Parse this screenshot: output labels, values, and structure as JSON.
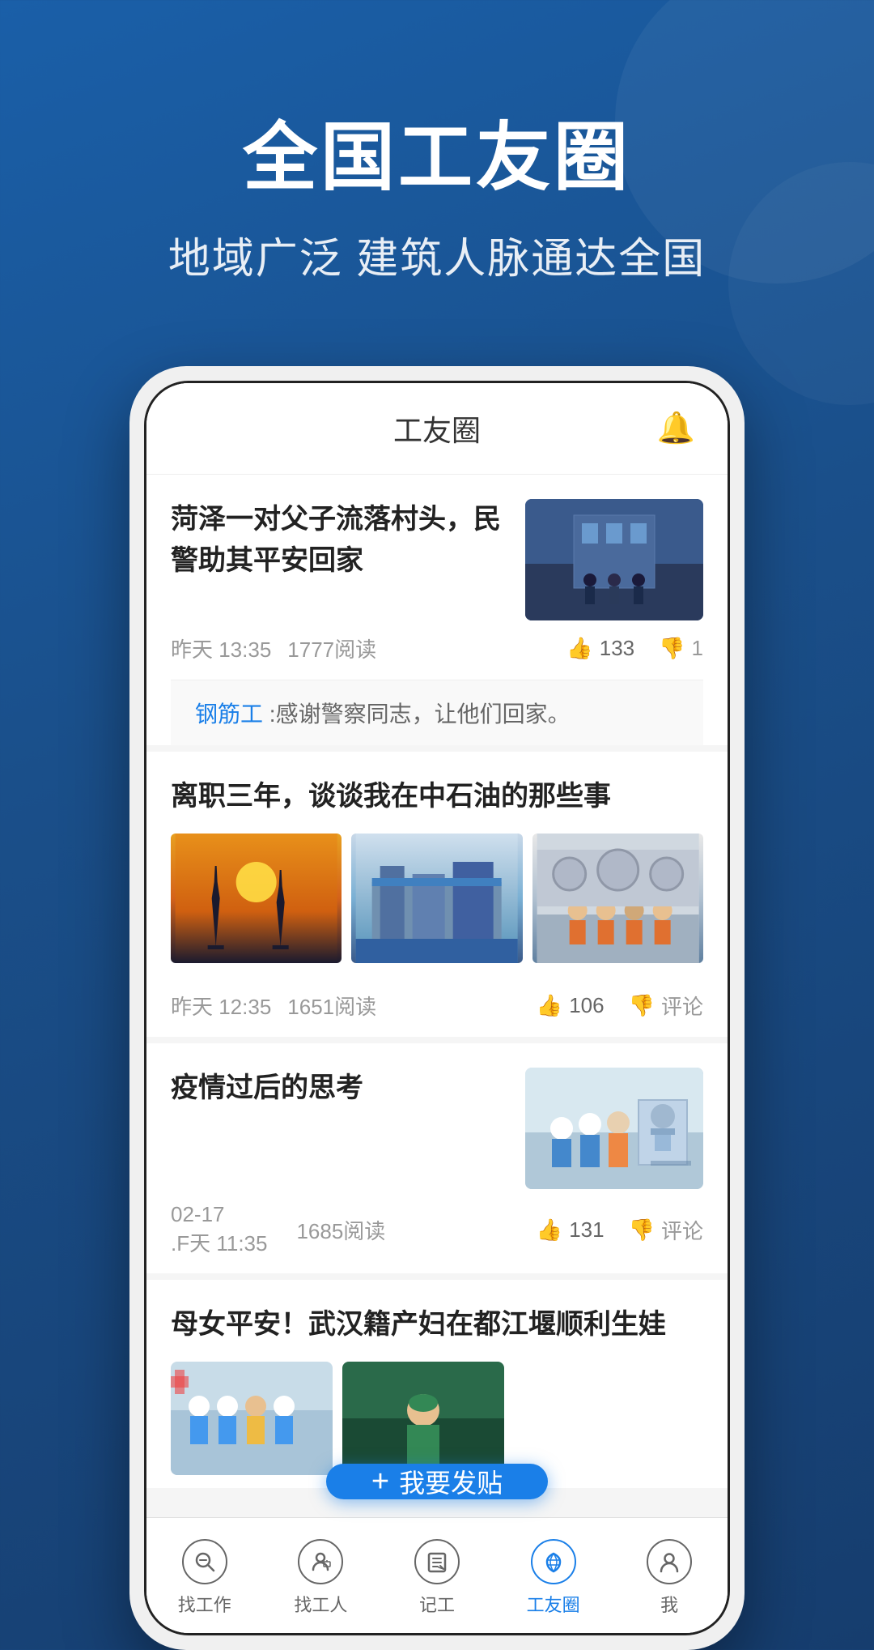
{
  "header": {
    "main_title": "全国工友圈",
    "sub_title": "地域广泛 建筑人脉通达全国"
  },
  "app": {
    "topbar": {
      "title": "工友圈",
      "bell_icon": "🔔"
    },
    "posts": [
      {
        "id": "post-1",
        "title": "菏泽一对父子流落村头，民警助其平安回家",
        "time": "昨天 13:35",
        "reads": "1777阅读",
        "likes": "133",
        "dislikes": "1",
        "has_single_image": true,
        "image_type": "police",
        "comment": {
          "username": "钢筋工",
          "text": ":感谢警察同志，让他们回家。"
        }
      },
      {
        "id": "post-2",
        "title": "离职三年，谈谈我在中石油的那些事",
        "time": "昨天 12:35",
        "reads": "1651阅读",
        "likes": "106",
        "dislikes_label": "评论",
        "has_three_images": true,
        "images": [
          "oil1",
          "oil2",
          "oil3"
        ]
      },
      {
        "id": "post-3",
        "title": "疫情过后的思考",
        "time": "02-17\n.F天 11:35",
        "reads": "1685阅读",
        "likes": "131",
        "dislikes_label": "评论",
        "has_single_image": true,
        "image_type": "pandemic"
      },
      {
        "id": "post-4",
        "title": "母女平安！武汉籍产妇在都江堰顺利生娃",
        "has_two_images": true,
        "images": [
          "baby",
          "baby2"
        ]
      }
    ],
    "fab": {
      "plus": "+",
      "label": "我要发贴"
    },
    "bottom_nav": [
      {
        "id": "find-work",
        "icon": "🔍",
        "label": "找工作",
        "active": false
      },
      {
        "id": "find-worker",
        "icon": "👔",
        "label": "找工人",
        "active": false
      },
      {
        "id": "record",
        "icon": "✏️",
        "label": "记工",
        "active": false
      },
      {
        "id": "worker-circle",
        "icon": "✈️",
        "label": "工友圈",
        "active": true
      },
      {
        "id": "profile",
        "icon": "👤",
        "label": "我",
        "active": false
      }
    ]
  }
}
